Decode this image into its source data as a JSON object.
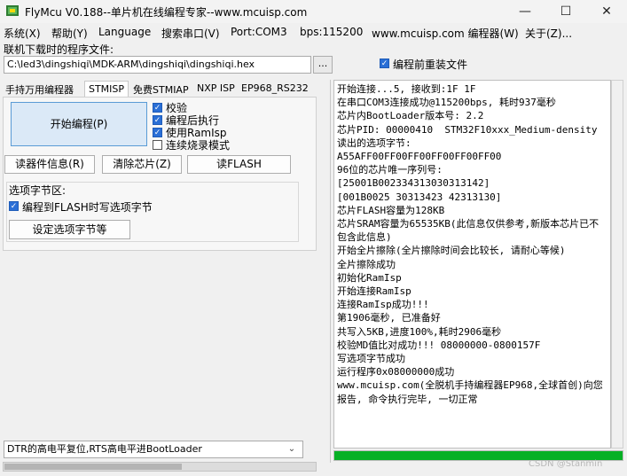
{
  "window": {
    "title": "FlyMcu V0.188--单片机在线编程专家--www.mcuisp.com",
    "minimize_glyph": "—",
    "maximize_glyph": "☐",
    "close_glyph": "✕"
  },
  "menu": [
    "系统(X)",
    "帮助(Y)",
    "Language",
    "搜索串口(V)",
    "Port:COM3",
    "bps:115200",
    "www.mcuisp.com 编程器(W)",
    "关于(Z)..."
  ],
  "file": {
    "label": "联机下载时的程序文件:",
    "path": "C:\\led3\\dingshiqi\\MDK-ARM\\dingshiqi\\dingshiqi.hex",
    "browse_label": "...",
    "reload_label": "编程前重装文件",
    "reload_checked": true
  },
  "tabs": [
    "手持万用编程器",
    "STMISP",
    "免费STMIAP",
    "NXP ISP",
    "EP968_RS232"
  ],
  "active_tab": "STMISP",
  "stmisp": {
    "start_button": "开始编程(P)",
    "options": [
      {
        "label": "校验",
        "checked": true
      },
      {
        "label": "编程后执行",
        "checked": true
      },
      {
        "label": "使用RamIsp",
        "checked": true
      },
      {
        "label": "连续烧录模式",
        "checked": false
      }
    ],
    "read_info_button": "读器件信息(R)",
    "erase_button": "清除芯片(Z)",
    "read_flash_button": "读FLASH",
    "option_bytes": {
      "group_title": "选项字节区:",
      "write_label": "编程到FLASH时写选项字节",
      "write_checked": true,
      "set_button": "设定选项字节等"
    }
  },
  "reset_mode": "DTR的高电平复位,RTS高电平进BootLoader",
  "log_lines": [
    "开始连接...5, 接收到:1F 1F",
    "在串口COM3连接成功@115200bps, 耗时937毫秒",
    "芯片内BootLoader版本号: 2.2",
    "芯片PID: 00000410  STM32F10xxx_Medium-density",
    "读出的选项字节:",
    "A55AFF00FF00FF00FF00FF00FF00",
    "96位的芯片唯一序列号:",
    "[25001B002334313030313142]",
    "[001B0025 30313423 42313130]",
    "芯片FLASH容量为128KB",
    "芯片SRAM容量为65535KB(此信息仅供参考,新版本芯片已不包含此信息)",
    "开始全片擦除(全片擦除时间会比较长, 请耐心等候)",
    "全片擦除成功",
    "初始化RamIsp",
    "开始连接RamIsp",
    "连接RamIsp成功!!!",
    "第1906毫秒, 已准备好",
    "共写入5KB,进度100%,耗时2906毫秒",
    "校验MD值比对成功!!! 08000000-0800157F",
    "写选项字节成功",
    "运行程序0x08000000成功",
    "www.mcuisp.com(全脱机手持编程器EP968,全球首创)向您报告, 命令执行完毕, 一切正常"
  ],
  "progress_fraction": 1.0,
  "watermark": "CSDN @Stanmin",
  "colors": {
    "progress": "#06b025",
    "accent": "#2a6fd6",
    "primary_button": "#dbe9f7"
  }
}
